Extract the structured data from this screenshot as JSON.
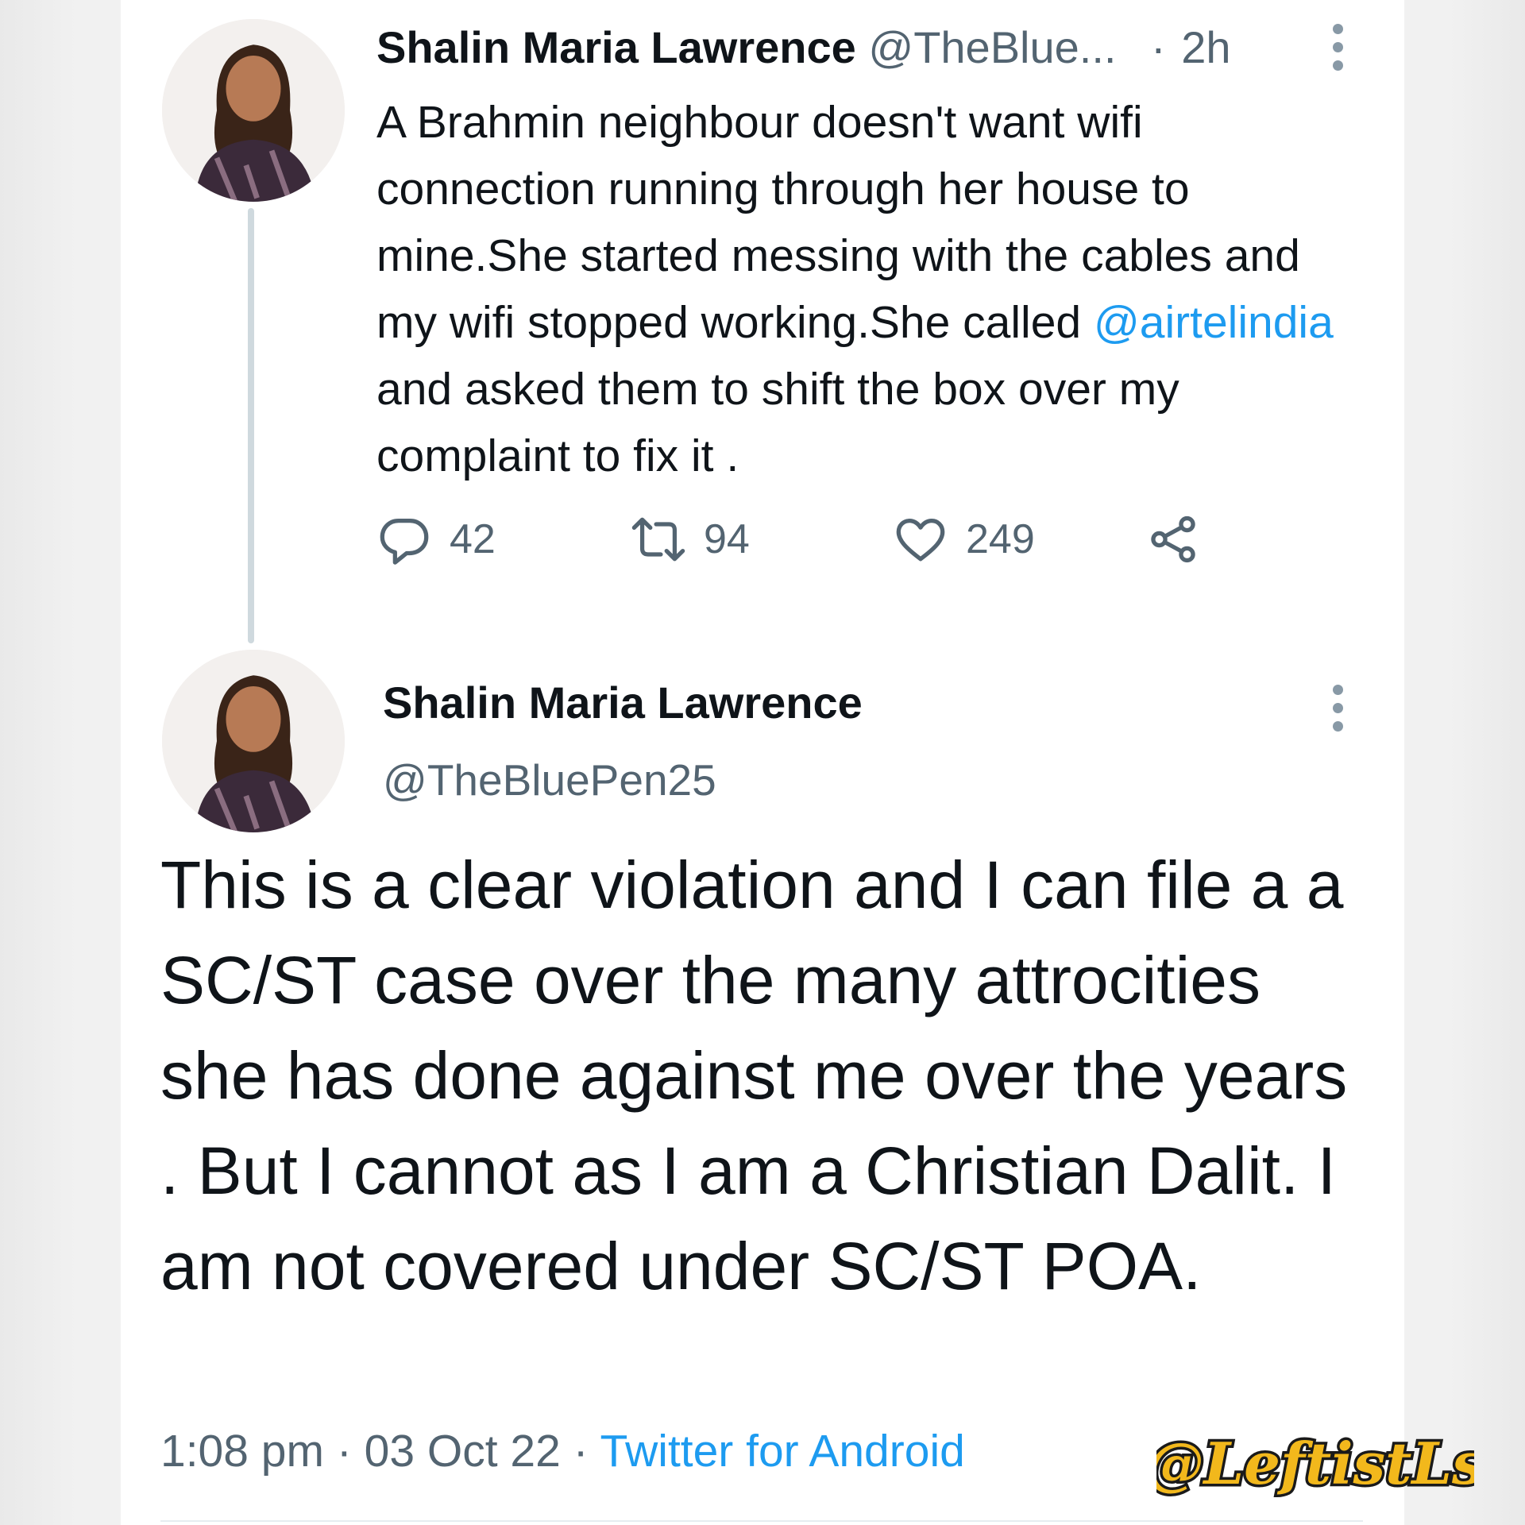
{
  "tweet1": {
    "author_name": "Shalin Maria Lawrence",
    "author_handle": "@TheBlue...",
    "separator": "·",
    "time": "2h",
    "text_before_mention": "A Brahmin neighbour doesn't want wifi connection running through her house to mine.She started messing with the cables and my wifi stopped working.She called ",
    "mention": "@airtelindia",
    "text_after_mention": " and asked them to shift the box over my complaint to fix it .",
    "replies": "42",
    "retweets": "94",
    "likes": "249"
  },
  "tweet2": {
    "author_name": "Shalin Maria Lawrence",
    "author_handle": "@TheBluePen25",
    "text": "This is a clear violation and I can file a a SC/ST case over the many attrocities she has done against me over the years . But I cannot as I am a Christian Dalit. I am not covered under SC/ST POA.",
    "time": "1:08 pm",
    "separator1": "·",
    "date": "03 Oct 22",
    "separator2": "·",
    "source": "Twitter for Android"
  },
  "watermark": "@LeftistLs",
  "icons": {
    "reply": "reply-icon",
    "retweet": "retweet-icon",
    "like": "heart-icon",
    "share": "share-icon",
    "more": "more-vertical-icon"
  },
  "colors": {
    "link": "#1d9bf0",
    "secondary_text": "#536471",
    "primary_text": "#0f1419",
    "watermark_fill": "#f2b81c"
  }
}
